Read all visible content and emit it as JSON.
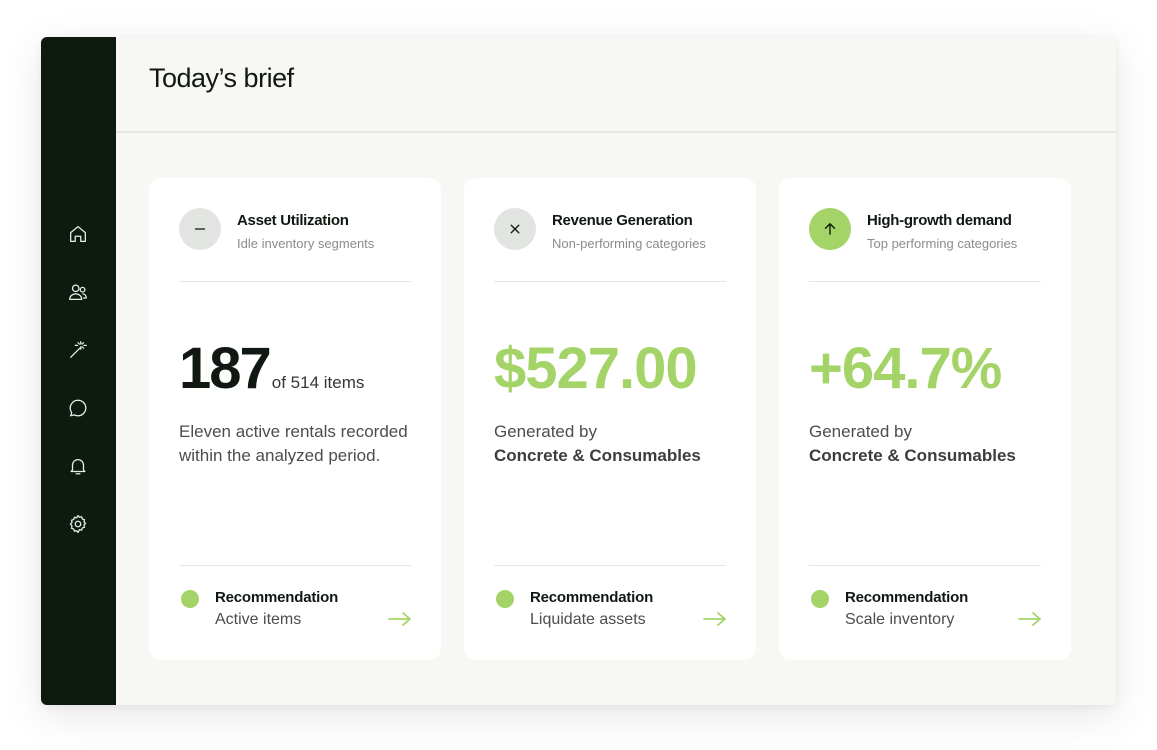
{
  "header": {
    "title": "Today’s brief"
  },
  "sidebar": {
    "items": [
      {
        "name": "home",
        "icon": "home-icon"
      },
      {
        "name": "users",
        "icon": "users-icon"
      },
      {
        "name": "magic",
        "icon": "magic-wand-icon"
      },
      {
        "name": "messages",
        "icon": "chat-icon"
      },
      {
        "name": "notifications",
        "icon": "bell-icon"
      },
      {
        "name": "settings",
        "icon": "gear-icon"
      }
    ]
  },
  "colors": {
    "accent": "#a4d468",
    "sidebar": "#0c1a0f",
    "text": "#111812"
  },
  "cards": [
    {
      "icon": "minus-icon",
      "title": "Asset Utilization",
      "subtitle": "Idle inventory segments",
      "metric": "187",
      "metric_suffix": "of 514 items",
      "description": "Eleven active rentals recorded within the analyzed period.",
      "recommendation_label": "Recommendation",
      "recommendation_value": "Active items"
    },
    {
      "icon": "x-icon",
      "title": "Revenue Generation",
      "subtitle": "Non-performing categories",
      "metric": "$527.00",
      "description_prefix": "Generated by",
      "description_bold": "Concrete & Consumables",
      "recommendation_label": "Recommendation",
      "recommendation_value": "Liquidate assets"
    },
    {
      "icon": "arrow-up-icon",
      "title": "High-growth demand",
      "subtitle": "Top performing categories",
      "metric": "+64.7%",
      "description_prefix": "Generated by",
      "description_bold": "Concrete & Consumables",
      "recommendation_label": "Recommendation",
      "recommendation_value": "Scale inventory"
    }
  ]
}
